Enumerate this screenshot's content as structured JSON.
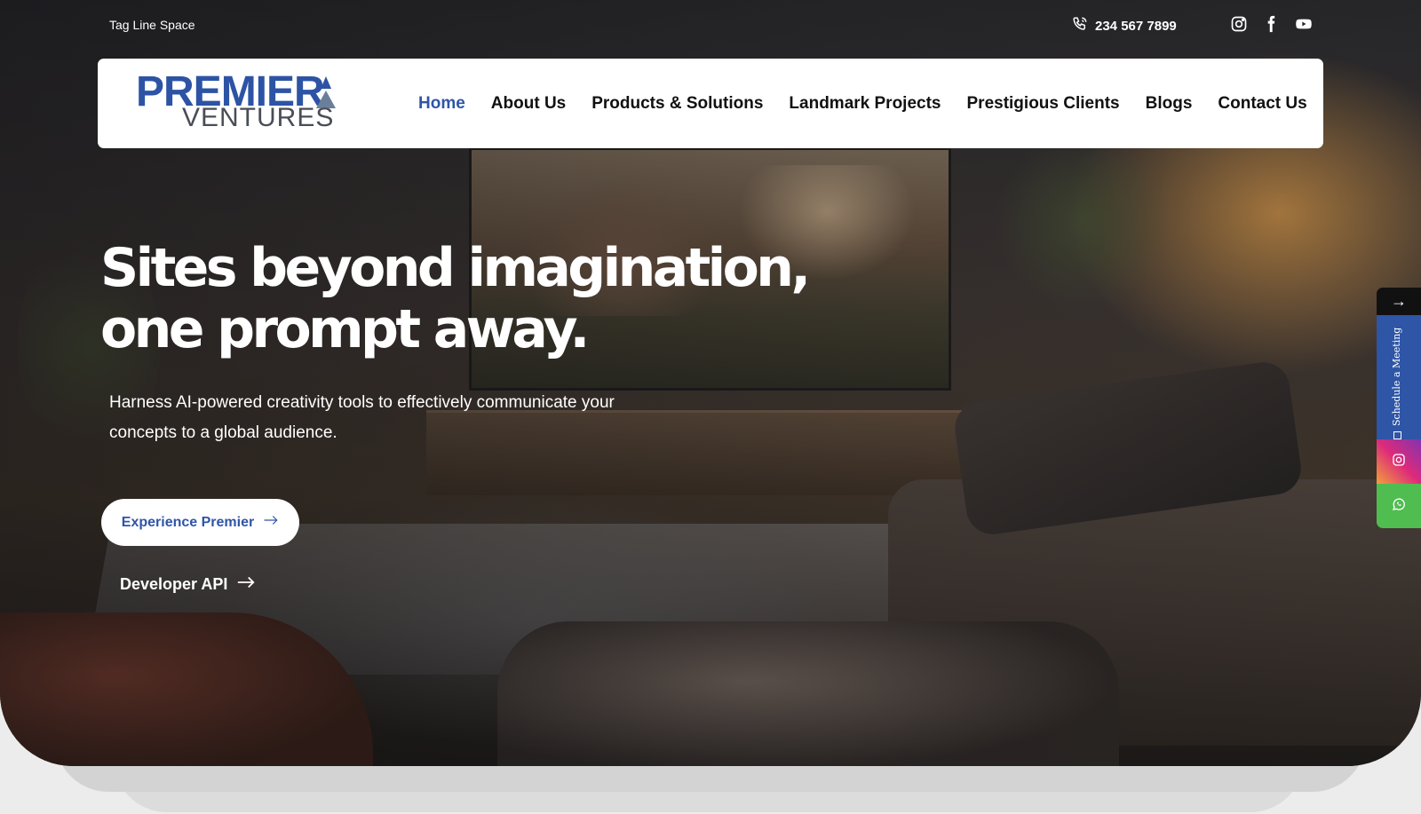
{
  "topbar": {
    "tagline": "Tag Line Space",
    "phone": "234 567 7899",
    "social_icons": [
      "instagram-icon",
      "facebook-icon",
      "youtube-icon"
    ]
  },
  "logo": {
    "line1": "PREMIER",
    "line2": "VENTURES"
  },
  "nav": {
    "items": [
      "Home",
      "About Us",
      "Products & Solutions",
      "Landmark Projects",
      "Prestigious Clients",
      "Blogs",
      "Contact Us"
    ],
    "active": "Home"
  },
  "hero": {
    "headline": "Sites beyond imagination, one prompt away.",
    "subtitle": "Harness AI-powered creativity tools to effectively communicate your concepts to a global audience.",
    "cta_label": "Experience Premier",
    "secondary_label": "Developer API"
  },
  "side_widget": {
    "arrow": "→",
    "meeting_label": "Schedule a Meeting"
  },
  "colors": {
    "brand_blue": "#2f55a8",
    "logo_gray": "#4a4d57",
    "whatsapp_green": "#4fbd4f"
  }
}
